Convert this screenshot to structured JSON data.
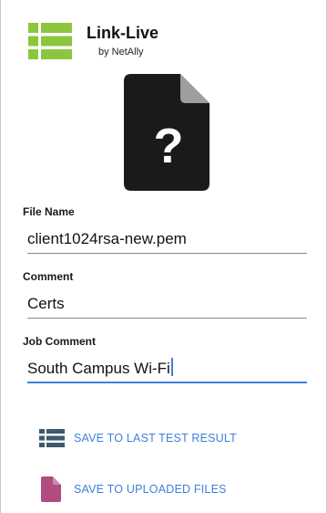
{
  "app": {
    "title": "Link-Live",
    "subtitle": "by NetAlly",
    "logo_icon": "list-grid-icon",
    "logo_color": "#8cc63e"
  },
  "file_preview": {
    "icon": "unknown-file-icon",
    "glyph": "?",
    "color": "#1a1a1a",
    "fold_color": "#9e9e9e"
  },
  "form": {
    "file_name": {
      "label": "File Name",
      "value": "client1024rsa-new.pem"
    },
    "comment": {
      "label": "Comment",
      "value": "Certs"
    },
    "job_comment": {
      "label": "Job Comment",
      "value": "South Campus Wi-Fi"
    }
  },
  "actions": {
    "save_last_test": {
      "label": "SAVE TO LAST TEST RESULT",
      "icon": "list-icon",
      "icon_color": "#3d5a6e"
    },
    "save_uploaded": {
      "label": "SAVE TO UPLOADED FILES",
      "icon": "file-icon",
      "icon_color": "#b04c82"
    }
  },
  "colors": {
    "accent": "#3f7fd8"
  }
}
